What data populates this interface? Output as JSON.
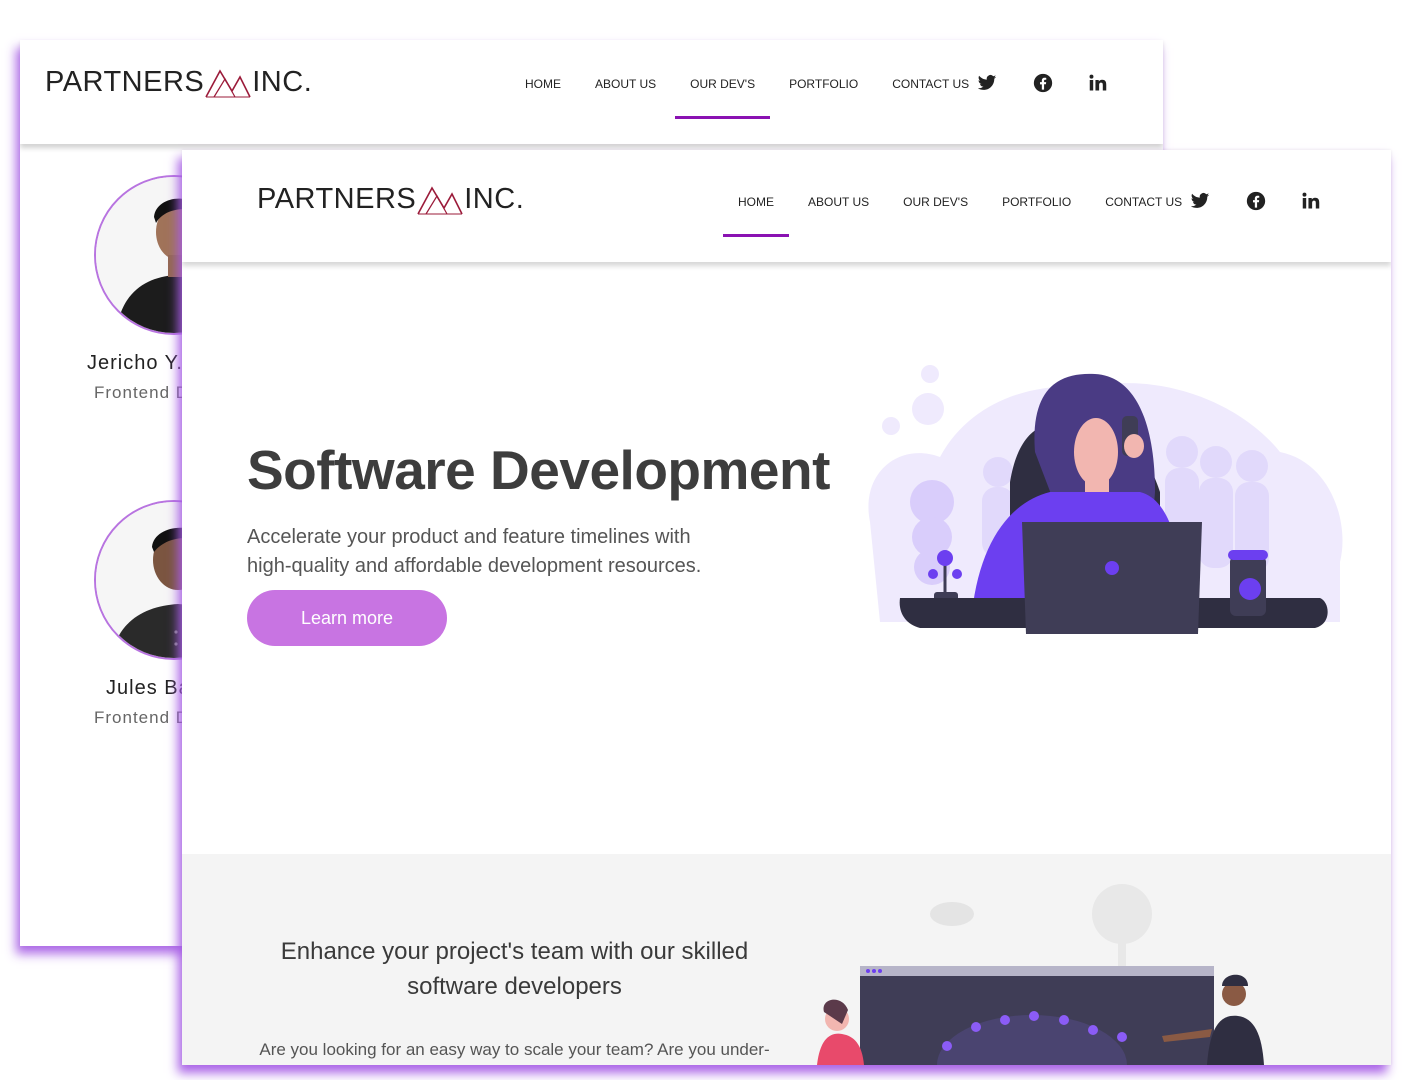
{
  "back_window": {
    "logo": {
      "left": "PARTNERS",
      "right": "INC."
    },
    "nav": [
      "HOME",
      "ABOUT US",
      "OUR DEV'S",
      "PORTFOLIO",
      "CONTACT US"
    ],
    "active_nav": "OUR DEV'S",
    "social_icons": [
      "twitter-icon",
      "facebook-icon",
      "linkedin-icon"
    ],
    "developers": [
      {
        "name": "Jericho Y.",
        "role": "Frontend D"
      },
      {
        "name": "Jules Ba",
        "role": "Frontend D"
      }
    ]
  },
  "front_window": {
    "logo": {
      "left": "PARTNERS",
      "right": "INC."
    },
    "nav": [
      "HOME",
      "ABOUT US",
      "OUR DEV'S",
      "PORTFOLIO",
      "CONTACT US"
    ],
    "active_nav": "HOME",
    "social_icons": [
      "twitter-icon",
      "facebook-icon",
      "linkedin-icon"
    ],
    "hero": {
      "title": "Software Development",
      "subtitle_line1": "Accelerate your product and feature timelines with",
      "subtitle_line2": "high-quality and affordable development resources.",
      "button": "Learn more"
    },
    "section2": {
      "title_line1": "Enhance your project's team with our skilled",
      "title_line2": "software developers",
      "text": "Are you looking for an easy way to scale your team? Are you under-"
    }
  },
  "colors": {
    "accent": "#8a12b2",
    "button": "#c874e2",
    "illustration_purple": "#6c3ff0",
    "illustration_dark": "#3f3d56",
    "shadow": "#a65de6"
  }
}
